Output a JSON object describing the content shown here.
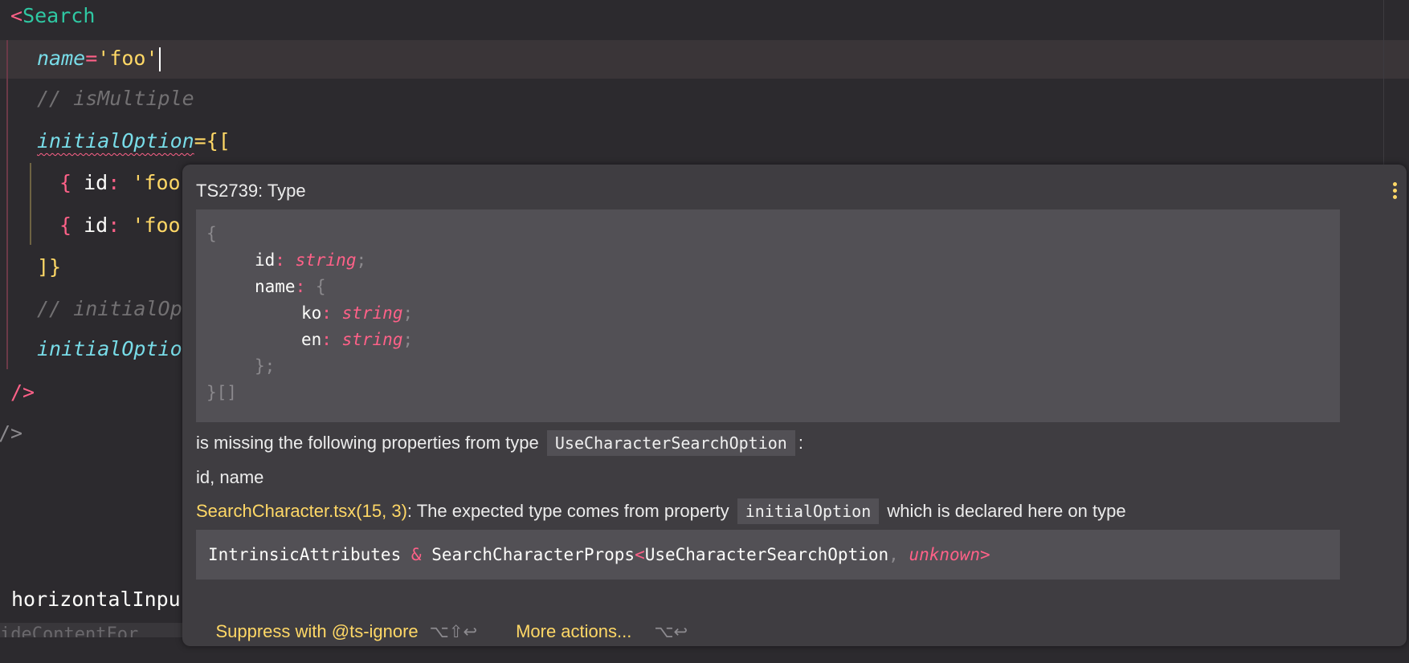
{
  "editor": {
    "lines": {
      "search_open_bracket": "<",
      "search_tag": "Search",
      "name_attr": "name",
      "equals": "=",
      "name_value": "'foo'",
      "comment_is_multiple": "// isMultiple",
      "initial_option_attr": "initialOption",
      "initial_option_open": "={[",
      "item1_brace": "{",
      "item1_key": "id",
      "item1_colon": ":",
      "item1_value": "'foo",
      "item2_brace": "{",
      "item2_key": "id",
      "item2_colon": ":",
      "item2_value": "'foo",
      "close_array": "]}",
      "comment_initial_op": "// initialOp",
      "initial_option_attr2": "initialOptio",
      "self_close_1": "/>",
      "self_close_2": "/>",
      "horizontal_input": "horizontalInpu",
      "bottom_partial": "ideContentFor"
    }
  },
  "popup": {
    "title": "TS2739: Type",
    "type_code": {
      "open": "{",
      "id_key": "id",
      "id_type": "string",
      "name_key": "name",
      "name_open": "{",
      "ko_key": "ko",
      "ko_type": "string",
      "en_key": "en",
      "en_type": "string",
      "name_close": "};",
      "close": "}[]",
      "colon": ":",
      "semicolon": ";"
    },
    "missing_text": "is missing the following properties from type",
    "missing_type": "UseCharacterSearchOption",
    "missing_colon": ":",
    "missing_props": "id, name",
    "source_link": "SearchCharacter.tsx(15, 3)",
    "source_text": ": The expected type comes from property",
    "source_property": "initialOption",
    "source_text2": "which is declared here on type",
    "declared_type": {
      "part1": "IntrinsicAttributes",
      "amp": "&",
      "part2": "SearchCharacterProps",
      "lt": "<",
      "part3": "UseCharacterSearchOption",
      "comma": ",",
      "part4": "unknown",
      "gt": ">"
    },
    "actions": {
      "suppress_label": "Suppress with @ts-ignore",
      "suppress_shortcut": "⌥⇧↩",
      "more_label": "More actions...",
      "more_shortcut": "⌥↩"
    }
  },
  "colors": {
    "editor_bg": "#2c2a2e",
    "popup_bg": "#3f3d41",
    "code_block_bg": "#525055",
    "accent_yellow": "#ffd866",
    "accent_pink": "#ff6188",
    "tag_teal": "#2fc8a3",
    "attr_cyan": "#78dce8"
  }
}
